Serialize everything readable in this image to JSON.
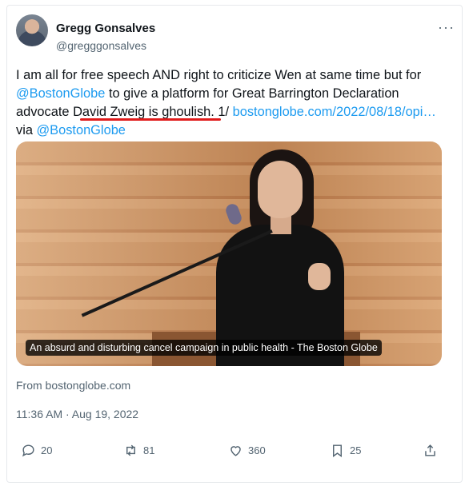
{
  "author": {
    "name": "Gregg Gonsalves",
    "handle": "@gregggonsalves"
  },
  "tweet": {
    "text_1": "I am all for free speech AND right to criticize Wen at same time but for ",
    "mention_1": "@BostonGlobe",
    "text_2": " to give a platform for Great Barrington Declaration advocate David Zweig is ghoulish. 1/ ",
    "url": "bostonglobe.com/2022/08/18/opi…",
    "text_3": " via ",
    "mention_2": "@BostonGlobe"
  },
  "media": {
    "caption": "An absurd and disturbing cancel campaign in public health - The Boston Globe"
  },
  "source": "From bostonglobe.com",
  "timestamp": "11:36 AM · Aug 19, 2022",
  "actions": {
    "replies": "20",
    "retweets": "81",
    "likes": "360",
    "bookmarks": "25"
  },
  "icons": [
    "more-icon",
    "reply-icon",
    "retweet-icon",
    "like-icon",
    "bookmark-icon",
    "share-icon"
  ],
  "colors": {
    "link": "#1d9bf0",
    "text": "#0f1419",
    "muted": "#536471",
    "highlight_underline": "#e01b1b"
  }
}
